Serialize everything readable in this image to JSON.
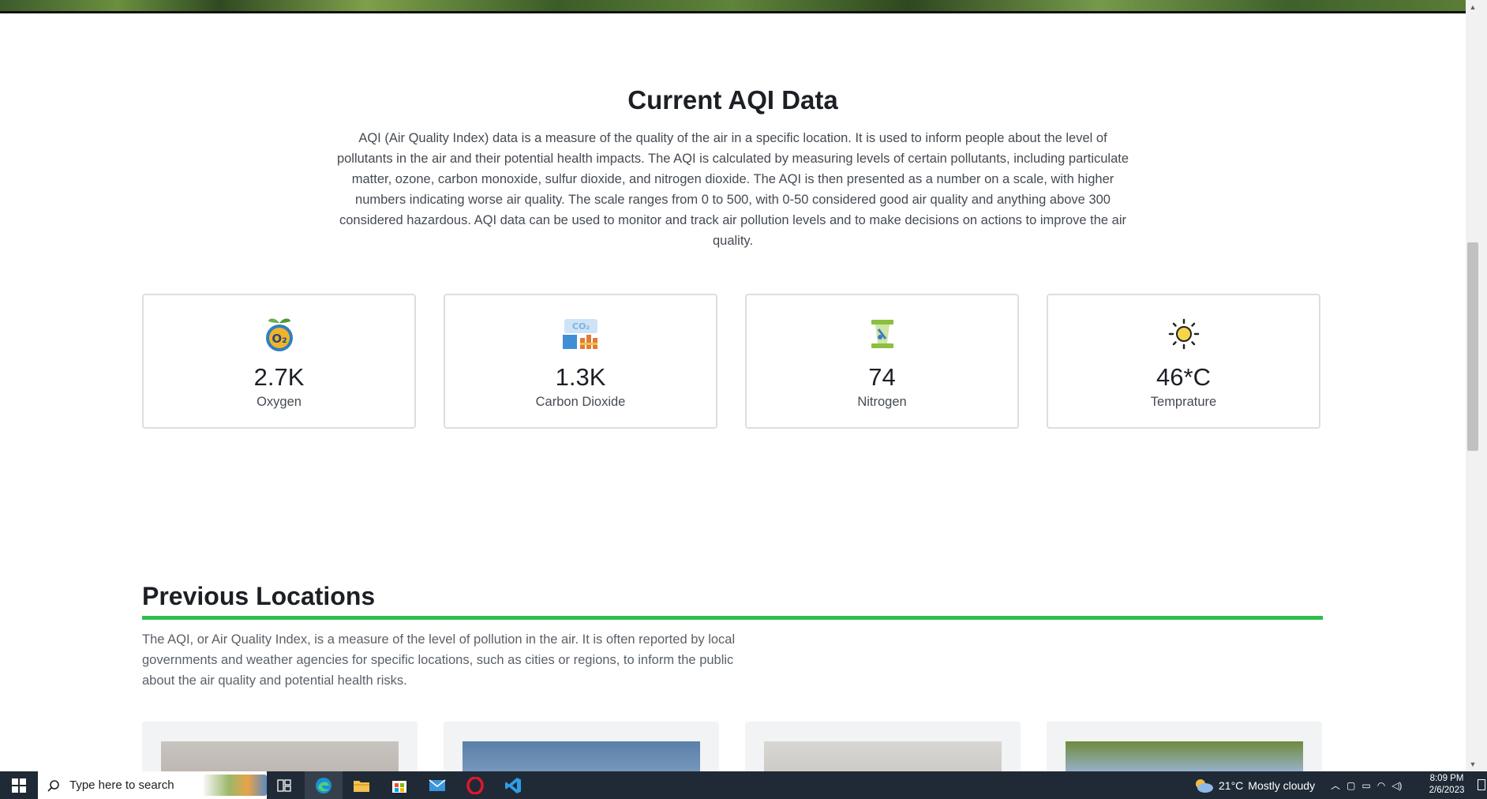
{
  "aqi": {
    "title": "Current AQI Data",
    "description": "AQI (Air Quality Index) data is a measure of the quality of the air in a specific location. It is used to inform people about the level of pollutants in the air and their potential health impacts. The AQI is calculated by measuring levels of certain pollutants, including particulate matter, ozone, carbon monoxide, sulfur dioxide, and nitrogen dioxide. The AQI is then presented as a number on a scale, with higher numbers indicating worse air quality. The scale ranges from 0 to 500, with 0-50 considered good air quality and anything above 300 considered hazardous. AQI data can be used to monitor and track air pollution levels and to make decisions on actions to improve the air quality.",
    "stats": [
      {
        "value": "2.7K",
        "label": "Oxygen",
        "icon": "oxygen-o2-icon"
      },
      {
        "value": "1.3K",
        "label": "Carbon Dioxide",
        "icon": "co2-factory-icon"
      },
      {
        "value": "74",
        "label": "Nitrogen",
        "icon": "nitrogen-tube-icon"
      },
      {
        "value": "46*C",
        "label": "Temprature",
        "icon": "sun-icon"
      }
    ]
  },
  "previous": {
    "title": "Previous Locations",
    "description": "The AQI, or Air Quality Index, is a measure of the level of pollution in the air. It is often reported by local governments and weather agencies for specific locations, such as cities or regions, to inform the public about the air quality and potential health risks."
  },
  "taskbar": {
    "search_placeholder": "Type here to search",
    "weather_temp": "21°C",
    "weather_desc": "Mostly cloudy",
    "time": "8:09 PM",
    "date": "2/6/2023"
  },
  "colors": {
    "accent_green": "#2ebd4e",
    "taskbar_bg": "#1f2a36"
  }
}
